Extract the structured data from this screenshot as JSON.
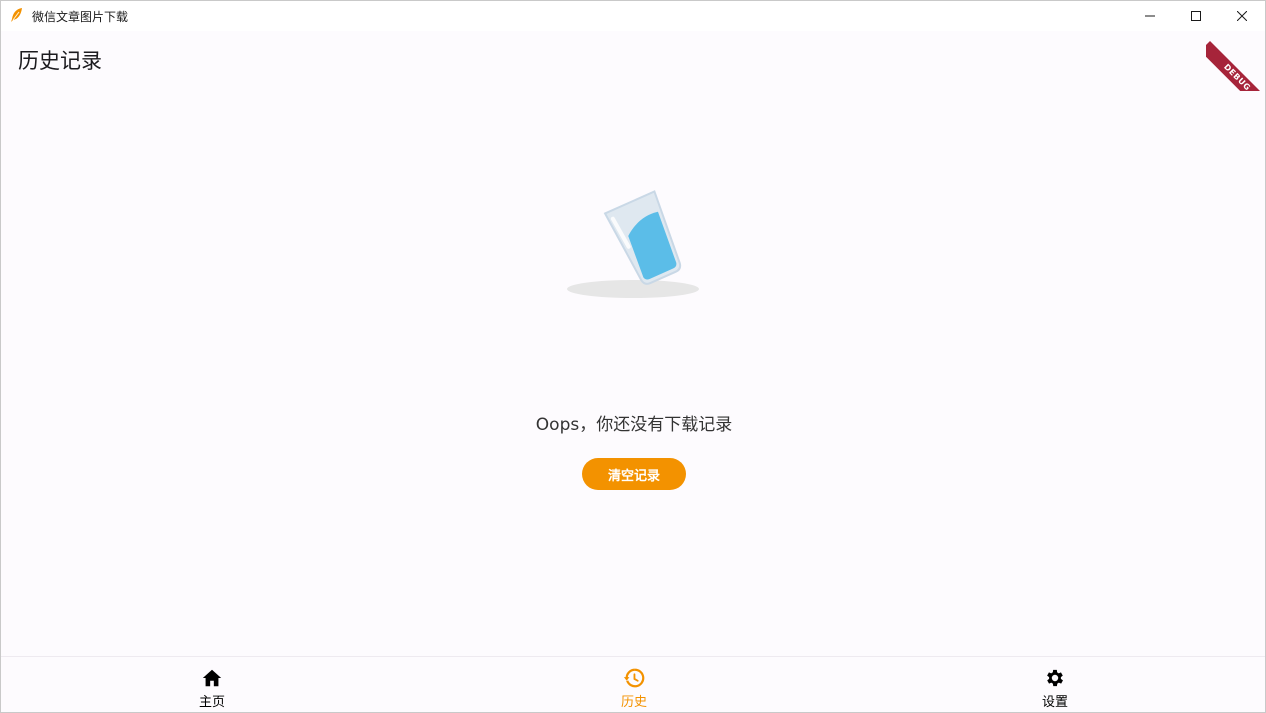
{
  "window": {
    "title": "微信文章图片下载",
    "icon": "feather-icon",
    "controls": [
      "minimize-icon",
      "maximize-icon",
      "close-icon"
    ]
  },
  "appbar": {
    "title": "历史记录",
    "debug_banner": "DEBUG"
  },
  "empty_state": {
    "illustration": "tipped-glass-illustration",
    "message": "Oops，你还没有下载记录",
    "button_label": "清空记录"
  },
  "bottom_nav": {
    "items": [
      {
        "label": "主页",
        "icon": "home-icon",
        "active": false
      },
      {
        "label": "历史",
        "icon": "history-icon",
        "active": true
      },
      {
        "label": "设置",
        "icon": "gear-icon",
        "active": false
      }
    ],
    "active_color": "#f39200",
    "inactive_color": "#000000"
  },
  "colors": {
    "accent": "#f39200",
    "background": "#fdfbfe",
    "debug_banner": "#a6243a"
  }
}
